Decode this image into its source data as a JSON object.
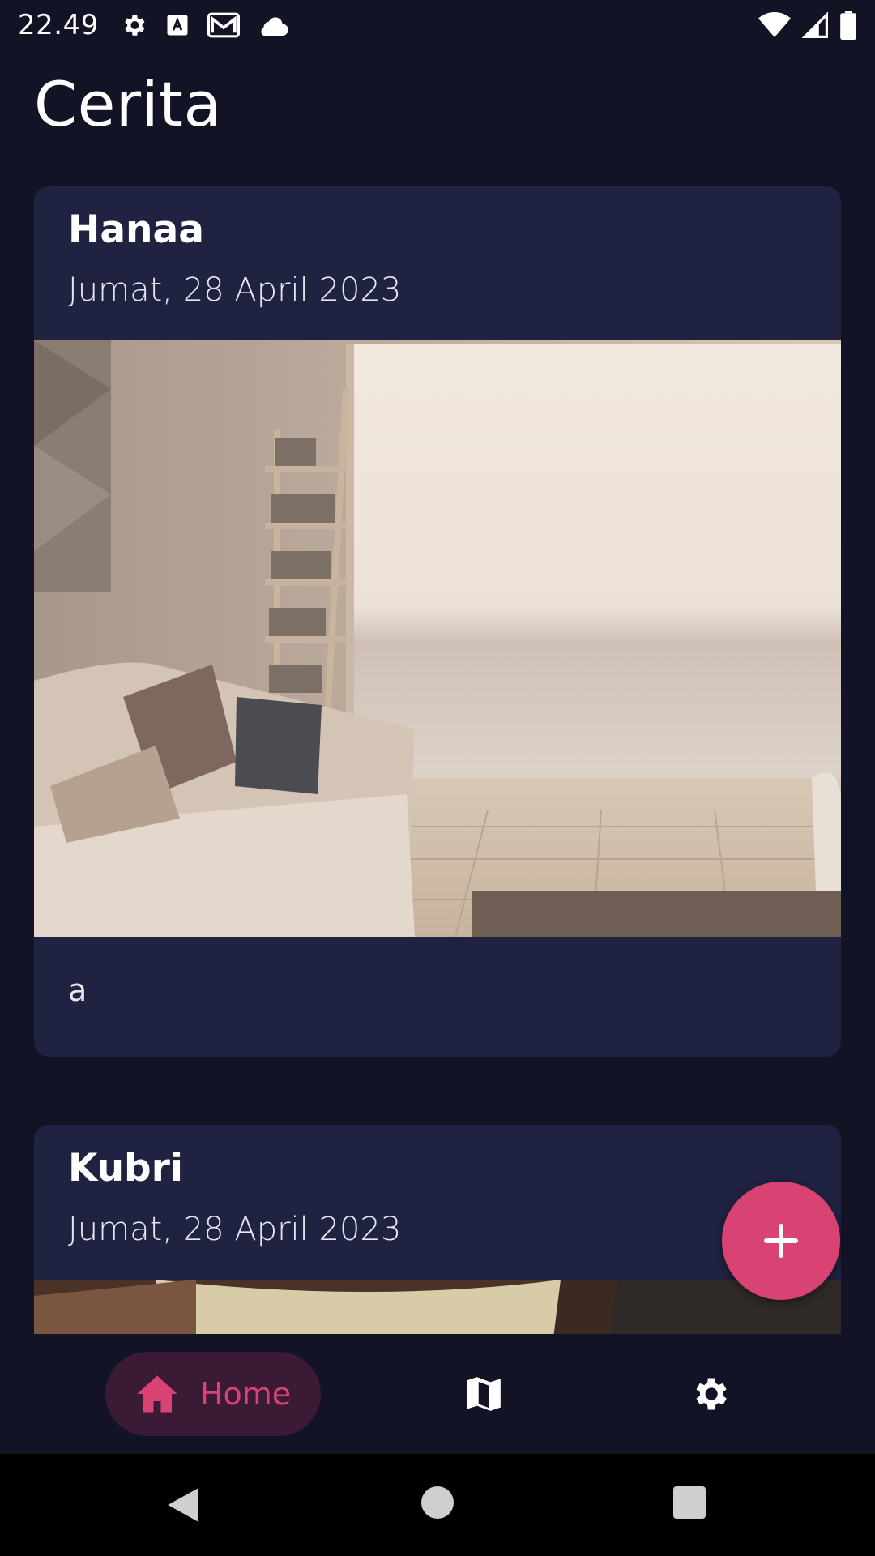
{
  "status_bar": {
    "time": "22.49",
    "left_icons": [
      "gear-icon",
      "text-badge-icon",
      "mail-icon",
      "cloud-icon"
    ],
    "right_icons": [
      "wifi-icon",
      "signal-icon",
      "battery-icon"
    ]
  },
  "page": {
    "title": "Cerita"
  },
  "stories": [
    {
      "author": "Hanaa",
      "date": "Jumat, 28 April 2023",
      "description": "a"
    },
    {
      "author": "Kubri",
      "date": "Jumat, 28 April 2023"
    }
  ],
  "bottom_nav": {
    "items": [
      {
        "label": "Home",
        "icon": "home-icon",
        "selected": true
      },
      {
        "icon": "map-icon",
        "selected": false
      },
      {
        "icon": "settings-icon",
        "selected": false
      }
    ]
  },
  "colors": {
    "background": "#121426",
    "card": "#1f2240",
    "accent": "#d94374",
    "nav_selected_bg": "#3a1a35"
  }
}
